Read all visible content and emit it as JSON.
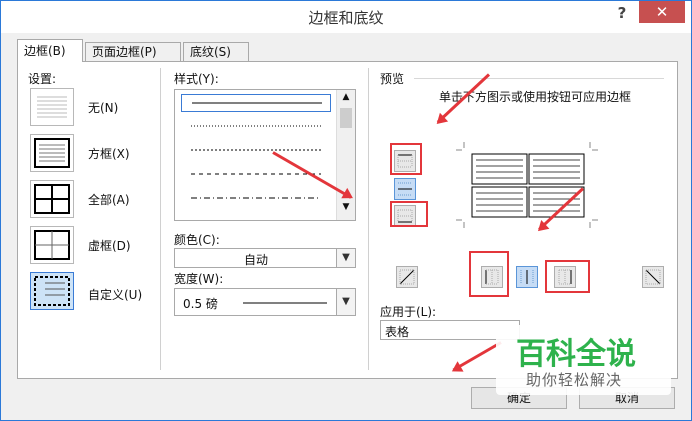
{
  "window": {
    "title": "边框和底纹",
    "help": "?",
    "close": "✕"
  },
  "tabs": [
    {
      "label": "边框(B)"
    },
    {
      "label": "页面边框(P)"
    },
    {
      "label": "底纹(S)"
    }
  ],
  "settings": {
    "heading": "设置:",
    "items": [
      {
        "label": "无(N)"
      },
      {
        "label": "方框(X)"
      },
      {
        "label": "全部(A)"
      },
      {
        "label": "虚框(D)"
      },
      {
        "label": "自定义(U)"
      }
    ]
  },
  "style": {
    "heading": "样式(Y):"
  },
  "color": {
    "heading": "颜色(C):",
    "value": "自动"
  },
  "width": {
    "heading": "宽度(W):",
    "value": "0.5 磅"
  },
  "preview": {
    "heading": "预览",
    "hint": "单击下方图示或使用按钮可应用边框"
  },
  "apply_to": {
    "heading": "应用于(L):",
    "value": "表格"
  },
  "buttons": {
    "ok": "确定",
    "cancel": "取消"
  },
  "watermark": {
    "title": "百科全说",
    "subtitle": "助你轻松解决"
  },
  "colors": {
    "accent": "#2b79d8",
    "annotation": "#e3363b",
    "watermark": "#2eb24c",
    "selected": "#cde3f7"
  }
}
